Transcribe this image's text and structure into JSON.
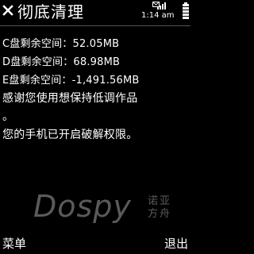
{
  "header": {
    "title": "彻底清理",
    "clock": "1:14 am"
  },
  "content": {
    "lines": [
      "C盘剩余空间：52.05MB",
      "D盘剩余空间：68.98MB",
      "E盘剩余空间：-1,491.56MB",
      "感谢您使用想保持低调作品",
      "。",
      "您的手机已开启破解权限。"
    ]
  },
  "watermark": {
    "text": "Dospy",
    "sub": "诺亚方舟"
  },
  "softkeys": {
    "left": "菜单",
    "right": "退出"
  },
  "colors": {
    "background": "#000000",
    "text": "#ffffff",
    "watermark": "#5a5a5a"
  },
  "icons": {
    "close": "close-icon",
    "signal": "signal-icon",
    "mail": "mail-icon",
    "battery": "battery-icon"
  }
}
